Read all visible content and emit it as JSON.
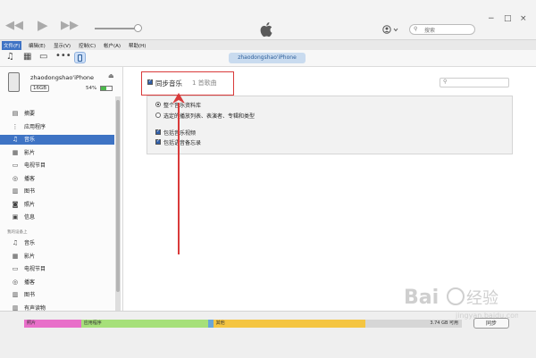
{
  "titlebar": {
    "icons": [
      "rewind-icon",
      "play-icon",
      "fast-forward-icon"
    ],
    "search_placeholder": "搜索",
    "window_controls": [
      "−",
      "□",
      "×"
    ]
  },
  "menubar": {
    "items": [
      "文件(F)",
      "编辑(E)",
      "显示(V)",
      "控制(C)",
      "帐户(A)",
      "帮助(H)"
    ]
  },
  "toolbar": {
    "icons": [
      "music-icon",
      "film-icon",
      "tv-icon",
      "more-icon"
    ],
    "device_tab": "zhaodongshao'iPhone"
  },
  "device": {
    "name": "zhaodongshao'iPhone",
    "capacity": "16GB",
    "battery_percent": "54%",
    "battery_level": 0.54
  },
  "sidebar": {
    "items": [
      {
        "icon": "summary-icon",
        "label": "摘要"
      },
      {
        "icon": "apps-icon",
        "label": "应用程序"
      },
      {
        "icon": "music-icon",
        "label": "音乐",
        "selected": true
      },
      {
        "icon": "film-icon",
        "label": "影片"
      },
      {
        "icon": "tv-icon",
        "label": "电视节目"
      },
      {
        "icon": "podcast-icon",
        "label": "播客"
      },
      {
        "icon": "book-icon",
        "label": "图书"
      },
      {
        "icon": "camera-icon",
        "label": "照片"
      },
      {
        "icon": "info-icon",
        "label": "信息"
      }
    ],
    "section_title": "我的设备上",
    "device_items": [
      {
        "icon": "music-icon",
        "label": "音乐"
      },
      {
        "icon": "film-icon",
        "label": "影片"
      },
      {
        "icon": "tv-icon",
        "label": "电视节目"
      },
      {
        "icon": "podcast-icon",
        "label": "播客"
      },
      {
        "icon": "book-icon",
        "label": "图书"
      },
      {
        "icon": "audiobook-icon",
        "label": "有声读物"
      }
    ]
  },
  "content": {
    "sync_label": "同步音乐",
    "sync_count": "1 首歌曲",
    "options": {
      "radio_all": "整个音乐资料库",
      "radio_selected": "选定的播放列表、表演者、专辑和类型",
      "check_videos": "包括音乐视频",
      "check_voice_memos": "包括语音备忘录"
    }
  },
  "storage": {
    "segments": [
      {
        "label": "照片",
        "color": "#e86fc9",
        "fraction": 0.13
      },
      {
        "label": "应用程序",
        "color": "#a6e07a",
        "fraction": 0.29
      },
      {
        "label": "",
        "color": "#6aa6d8",
        "fraction": 0.012
      },
      {
        "label": "其他",
        "color": "#f4c542",
        "fraction": 0.348
      },
      {
        "label": "3.74 GB 可用",
        "color": "#d6d6d6",
        "fraction": 0.22
      }
    ],
    "sync_button": "同步"
  },
  "watermark": {
    "text": "Bai du 经验",
    "url": "jingyan.baidu.com"
  }
}
